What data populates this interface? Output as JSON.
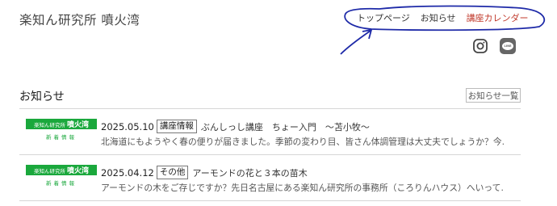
{
  "header": {
    "site_title": "楽知ん研究所 噴火湾",
    "nav": [
      {
        "label": "トップページ"
      },
      {
        "label": "お知らせ"
      },
      {
        "label": "講座カレンダー"
      }
    ],
    "accent_color": "#c0392b",
    "social": {
      "instagram_icon": "instagram-icon",
      "line_icon_label": "LINE"
    }
  },
  "news": {
    "section_title": "お知らせ",
    "more_label": "お知らせ一覧",
    "thumb": {
      "small": "楽知ん研究所",
      "big": "噴火湾",
      "sub": "新着情報",
      "color": "#1aa83c"
    },
    "items": [
      {
        "date": "2025.05.10",
        "category": "講座情報",
        "title": "ぶんしっし講座　ちょー入門　～苫小牧～",
        "excerpt": "北海道にもようやく春の便りが届きました。季節の変わり目、皆さん体調管理は大丈夫でしょうか？今..."
      },
      {
        "date": "2025.04.12",
        "category": "その他",
        "title": "アーモンドの花と３本の苗木",
        "excerpt": "アーモンドの木をご存じですか？先日名古屋にある楽知ん研究所の事務所（ころりんハウス）へいって..."
      }
    ]
  }
}
